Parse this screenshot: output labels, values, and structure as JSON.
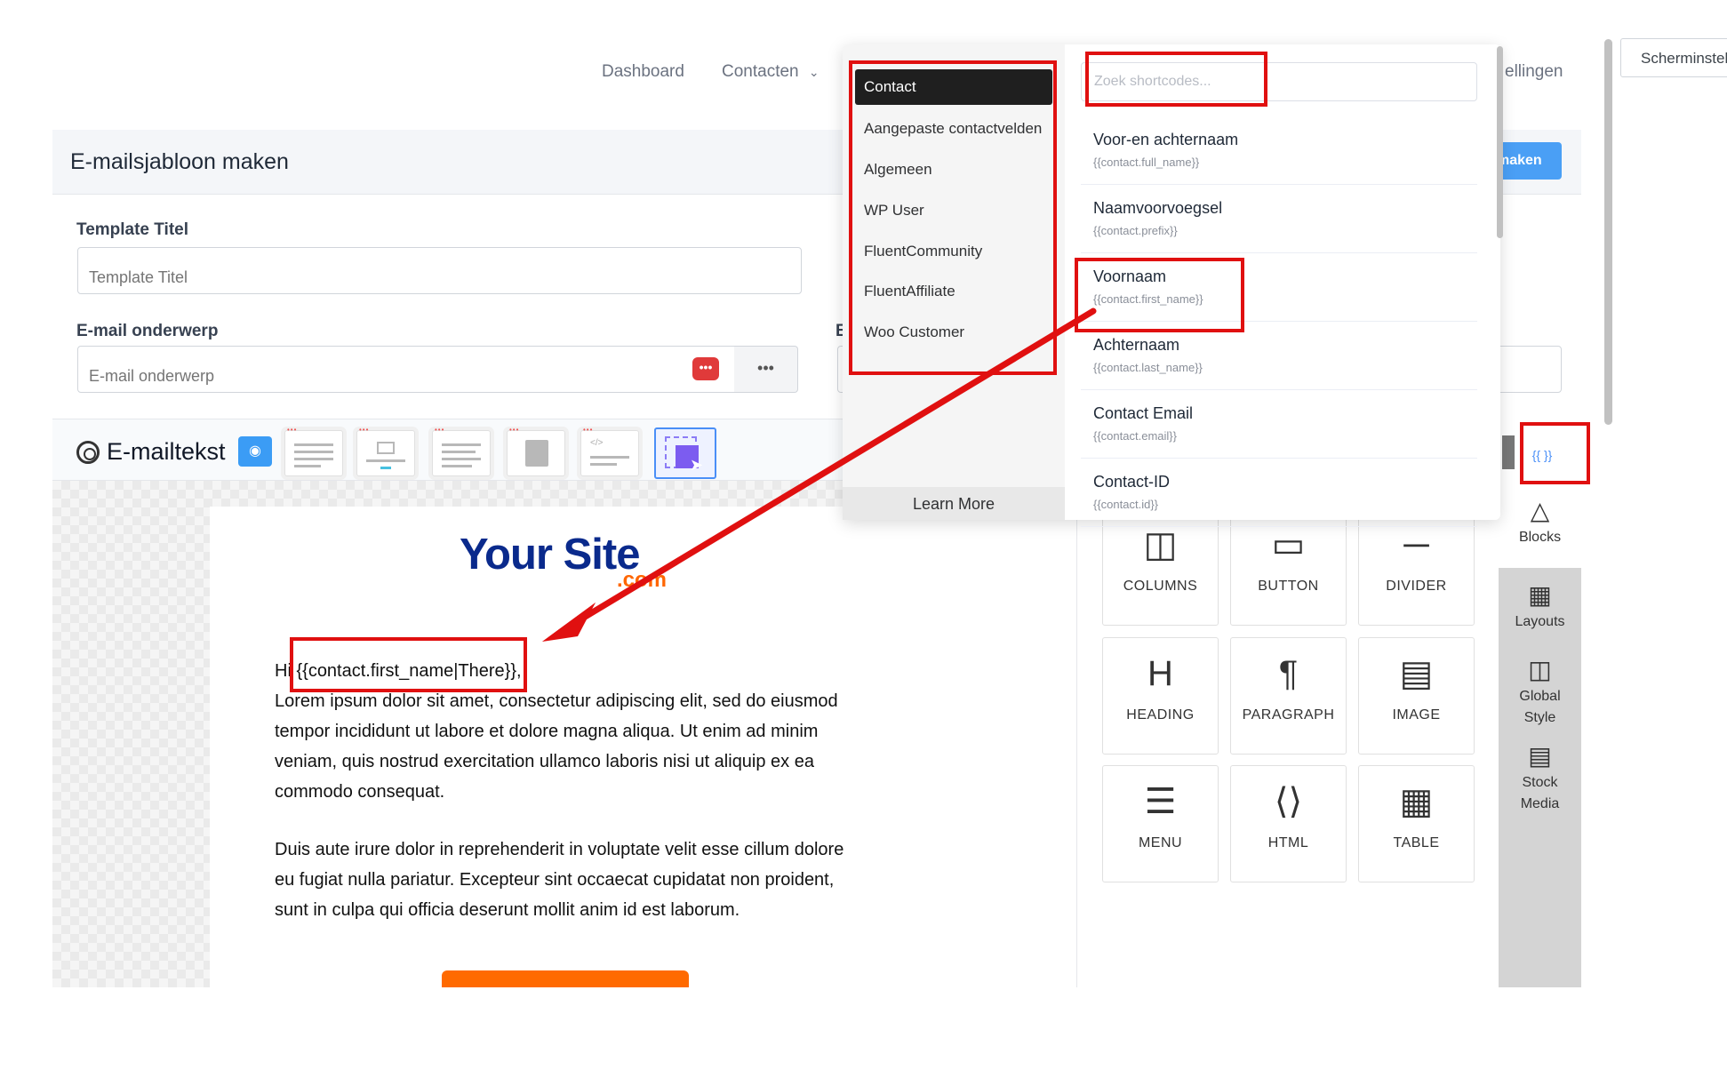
{
  "nav": {
    "dashboard": "Dashboard",
    "contacts": "Contacten",
    "settings_partial": "ellingen",
    "screen_options": "Scherminstel"
  },
  "panel": {
    "title": "E-mailsjabloon maken",
    "save_partial": "maken"
  },
  "form": {
    "template_title_label": "Template Titel",
    "template_title_placeholder": "Template Titel",
    "subject_label": "E-mail onderwerp",
    "subject_placeholder": "E-mail onderwerp",
    "preheader_label_partial": "E"
  },
  "toolbar": {
    "title": "E-mailtekst"
  },
  "email": {
    "logo_main": "Your Site",
    "logo_sub": ".com",
    "greeting_prefix": "Hi ",
    "greeting_shortcode": "{{contact.first_name|There}},",
    "paragraph1": "Lorem ipsum dolor sit amet, consectetur adipiscing elit, sed do eiusmod tempor incididunt ut labore et dolore magna aliqua. Ut enim ad minim veniam, quis nostrud exercitation ullamco laboris nisi ut aliquip ex ea commodo consequat.",
    "paragraph2": "Duis aute irure dolor in reprehenderit in voluptate velit esse cillum dolore eu fugiat nulla pariatur. Excepteur sint occaecat cupidatat non proident, sunt in culpa qui officia deserunt mollit anim id est laborum."
  },
  "blocks": [
    {
      "label": "COLUMNS",
      "icon": "columns-icon"
    },
    {
      "label": "BUTTON",
      "icon": "button-icon"
    },
    {
      "label": "DIVIDER",
      "icon": "divider-icon"
    },
    {
      "label": "HEADING",
      "icon": "heading-icon"
    },
    {
      "label": "PARAGRAPH",
      "icon": "paragraph-icon"
    },
    {
      "label": "IMAGE",
      "icon": "image-icon"
    },
    {
      "label": "MENU",
      "icon": "menu-icon"
    },
    {
      "label": "HTML",
      "icon": "html-icon"
    },
    {
      "label": "TABLE",
      "icon": "table-icon"
    }
  ],
  "side_nav": {
    "shortcode_toggle": "{{ }}",
    "blocks": "Blocks",
    "layouts": "Layouts",
    "global_style_1": "Global",
    "global_style_2": "Style",
    "stock_media_1": "Stock",
    "stock_media_2": "Media"
  },
  "shortcodes": {
    "categories": [
      "Contact",
      "Aangepaste contactvelden",
      "Algemeen",
      "WP User",
      "FluentCommunity",
      "FluentAffiliate",
      "Woo Customer"
    ],
    "learn_more": "Learn More",
    "search_placeholder": "Zoek shortcodes...",
    "items": [
      {
        "title": "Voor-en achternaam",
        "code": "{{contact.full_name}}"
      },
      {
        "title": "Naamvoorvoegsel",
        "code": "{{contact.prefix}}"
      },
      {
        "title": "Voornaam",
        "code": "{{contact.first_name}}"
      },
      {
        "title": "Achternaam",
        "code": "{{contact.last_name}}"
      },
      {
        "title": "Contact Email",
        "code": "{{contact.email}}"
      },
      {
        "title": "Contact-ID",
        "code": "{{contact.id}}"
      }
    ]
  },
  "colors": {
    "accent": "#4a9ff5",
    "annotation_red": "#e01010",
    "logo_blue": "#0a2a8c",
    "logo_orange": "#ff6600"
  }
}
